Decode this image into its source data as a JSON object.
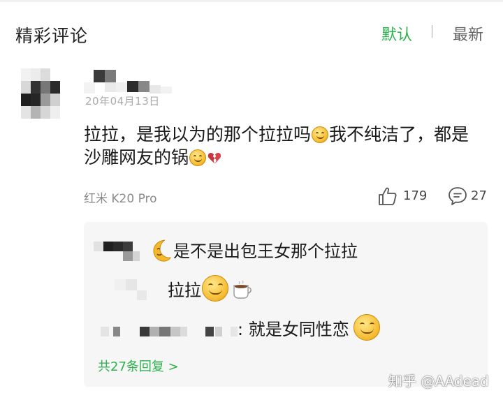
{
  "header": {
    "title": "精彩评论",
    "sort_default": "默认",
    "sort_separator": "|",
    "sort_latest": "最新"
  },
  "comment": {
    "date": "20年04月13日",
    "body_line1_a": "拉拉，是我以为的那个拉拉吗",
    "body_line1_b": "我不纯洁了，都是",
    "body_line2": "沙雕网友的锅",
    "device": "红米 K20 Pro",
    "like_count": "179",
    "reply_count": "27",
    "emoji_icons": [
      "smile-emoji",
      "smile-emoji",
      "broken-heart-emoji"
    ]
  },
  "replies": {
    "items": [
      {
        "text": "是不是出包王女那个拉拉",
        "emoji": "moon-emoji"
      },
      {
        "text": "拉拉",
        "emoji": [
          "smile-emoji",
          "coffee-emoji"
        ]
      },
      {
        "text": ": 就是女同性恋",
        "emoji": "smile-emoji"
      }
    ],
    "view_all_label": "共27条回复 >"
  },
  "watermark": "知乎 @AAdead",
  "colors": {
    "accent_green": "#2bb24c",
    "reply_background": "#f6f6f6",
    "secondary_text": "#8a8a8a"
  }
}
